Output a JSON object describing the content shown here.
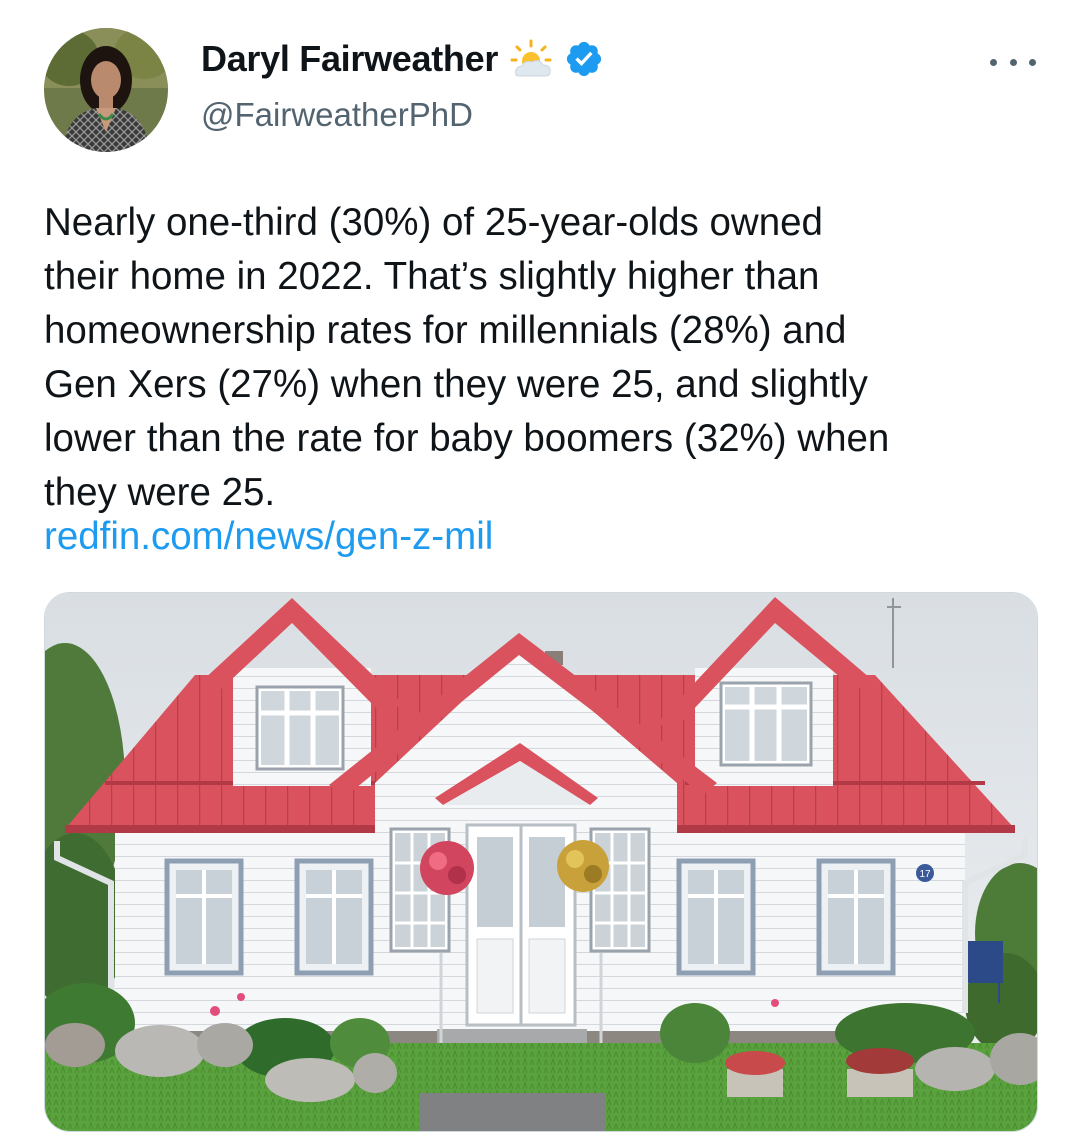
{
  "tweet": {
    "author_name": "Daryl Fairweather",
    "author_handle": "@FairweatherPhD",
    "name_emoji_icon": "sun-behind-cloud-icon",
    "verified_icon": "verified-badge-icon",
    "more_icon": "more-options-icon",
    "text": "Nearly one-third (30%) of 25-year-olds owned\ntheir home in 2022.  That’s slightly higher than\nhomeownership rates for millennials (28%) and\nGen Xers (27%) when they were 25, and slightly\nlower than the rate for baby boomers (32%) when\nthey were 25.",
    "link_text": "redfin.com/news/gen-z-mil",
    "house_number": "17"
  },
  "colors": {
    "link": "#1d9bf0",
    "verified": "#1d9bf0",
    "text": "#0f1419",
    "secondary": "#536471",
    "roof": "#d9525d"
  }
}
